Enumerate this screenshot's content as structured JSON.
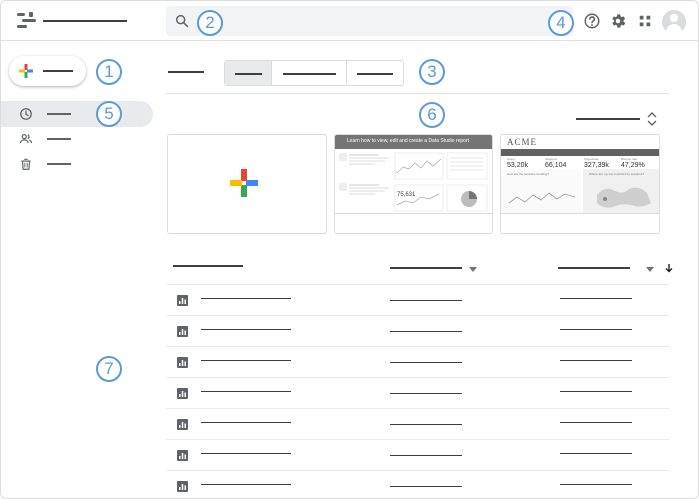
{
  "callouts": [
    "1",
    "2",
    "3",
    "4",
    "5",
    "6",
    "7"
  ],
  "icons": {
    "logo": "data-studio-logo-icon",
    "search": "search-icon",
    "help": "help-icon",
    "settings": "gear-icon",
    "apps": "apps-grid-icon",
    "account": "avatar-icon",
    "create": "plus-icon",
    "recent": "clock-icon",
    "shared": "people-icon",
    "trash": "trash-icon",
    "sort": "sort-arrows-icon",
    "report": "report-icon"
  },
  "colors": {
    "callout": "#5b9bd5",
    "plus_blue": "#4285f4",
    "plus_red": "#ea4335",
    "plus_yellow": "#fbbc04",
    "plus_green": "#34a853",
    "active_bg": "#e8eaed"
  },
  "templates": {
    "tutorial_heading": "Learn how to view, edit and create a Data Studio report",
    "acme_brand": "ACME",
    "acme_stats": [
      {
        "label": "Users",
        "value": "53,20k"
      },
      {
        "label": "Sessions",
        "value": "66,104"
      },
      {
        "label": "Pageviews",
        "value": "327,39k"
      },
      {
        "label": "Bounce rate",
        "value": "47,29%"
      }
    ],
    "acme_chart1_title": "How are the sessions trending?",
    "acme_chart2_title": "Where are my top countries by sessions?",
    "tutorial_metric": "75,631"
  }
}
